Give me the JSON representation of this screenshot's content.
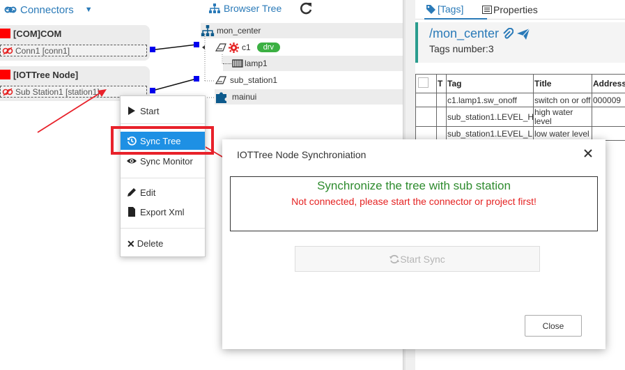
{
  "connectors": {
    "title": "Connectors",
    "groups": [
      {
        "name": "[COM]COM",
        "connection": "Conn1 [conn1]"
      },
      {
        "name": "[IOTTree Node]",
        "connection": "Sub Station1 [station1]"
      }
    ]
  },
  "browser_tree": {
    "title": "Browser Tree",
    "nodes": {
      "root": "mon_center",
      "c1": "c1",
      "c1_badge": "drv",
      "lamp1": "lamp1",
      "sub_station1": "sub_station1",
      "mainui": "mainui"
    }
  },
  "right_panel": {
    "tabs": {
      "tags": "[Tags]",
      "properties": "Properties"
    },
    "node_path": "/mon_center",
    "tags_count": "Tags number:3",
    "table": {
      "headers": {
        "check": "",
        "type": "T",
        "tag": "Tag",
        "title": "Title",
        "address": "Address"
      },
      "rows": [
        {
          "tag": "c1.lamp1.sw_onoff",
          "title": "switch on or off",
          "address": "000009"
        },
        {
          "tag": "sub_station1.LEVEL_H",
          "title": "high water level",
          "address": ""
        },
        {
          "tag": "sub_station1.LEVEL_L",
          "title": "low water level",
          "address": ""
        }
      ]
    }
  },
  "context_menu": {
    "start": "Start",
    "sync_tree": "Sync Tree",
    "sync_monitor": "Sync Monitor",
    "edit": "Edit",
    "export_xml": "Export Xml",
    "delete": "Delete"
  },
  "dialog": {
    "title": "IOTTree Node Synchroniation",
    "heading": "Synchronize the tree with sub station",
    "error": "Not connected, please start the connector or project first!",
    "start_sync_label": "Start Sync",
    "close_label": "Close"
  },
  "colors": {
    "accent": "#2a7ab8",
    "highlight_red": "#e8212a",
    "menu_selected": "#1e90e4",
    "success_green": "#2e8b2e",
    "error_red": "#e52222",
    "badge_green": "#3cb043"
  },
  "icons": [
    "link-icon",
    "caret-down-icon",
    "sitemap-icon",
    "refresh-icon",
    "broken-link-icon",
    "tag-icon",
    "list-icon",
    "paperclip-icon",
    "send-icon",
    "gear-icon",
    "lamp-icon",
    "device-icon",
    "puzzle-icon",
    "play-icon",
    "history-icon",
    "eye-icon",
    "pencil-icon",
    "file-icon",
    "times-icon",
    "close-icon"
  ]
}
